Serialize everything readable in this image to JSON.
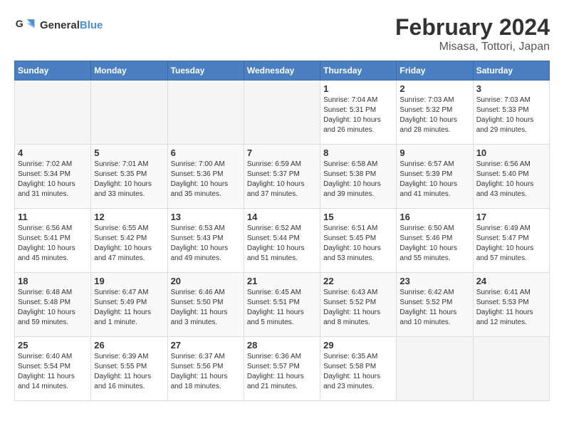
{
  "header": {
    "logo_line1": "General",
    "logo_line2": "Blue",
    "title": "February 2024",
    "subtitle": "Misasa, Tottori, Japan"
  },
  "weekdays": [
    "Sunday",
    "Monday",
    "Tuesday",
    "Wednesday",
    "Thursday",
    "Friday",
    "Saturday"
  ],
  "weeks": [
    [
      {
        "day": "",
        "info": ""
      },
      {
        "day": "",
        "info": ""
      },
      {
        "day": "",
        "info": ""
      },
      {
        "day": "",
        "info": ""
      },
      {
        "day": "1",
        "info": "Sunrise: 7:04 AM\nSunset: 5:31 PM\nDaylight: 10 hours\nand 26 minutes."
      },
      {
        "day": "2",
        "info": "Sunrise: 7:03 AM\nSunset: 5:32 PM\nDaylight: 10 hours\nand 28 minutes."
      },
      {
        "day": "3",
        "info": "Sunrise: 7:03 AM\nSunset: 5:33 PM\nDaylight: 10 hours\nand 29 minutes."
      }
    ],
    [
      {
        "day": "4",
        "info": "Sunrise: 7:02 AM\nSunset: 5:34 PM\nDaylight: 10 hours\nand 31 minutes."
      },
      {
        "day": "5",
        "info": "Sunrise: 7:01 AM\nSunset: 5:35 PM\nDaylight: 10 hours\nand 33 minutes."
      },
      {
        "day": "6",
        "info": "Sunrise: 7:00 AM\nSunset: 5:36 PM\nDaylight: 10 hours\nand 35 minutes."
      },
      {
        "day": "7",
        "info": "Sunrise: 6:59 AM\nSunset: 5:37 PM\nDaylight: 10 hours\nand 37 minutes."
      },
      {
        "day": "8",
        "info": "Sunrise: 6:58 AM\nSunset: 5:38 PM\nDaylight: 10 hours\nand 39 minutes."
      },
      {
        "day": "9",
        "info": "Sunrise: 6:57 AM\nSunset: 5:39 PM\nDaylight: 10 hours\nand 41 minutes."
      },
      {
        "day": "10",
        "info": "Sunrise: 6:56 AM\nSunset: 5:40 PM\nDaylight: 10 hours\nand 43 minutes."
      }
    ],
    [
      {
        "day": "11",
        "info": "Sunrise: 6:56 AM\nSunset: 5:41 PM\nDaylight: 10 hours\nand 45 minutes."
      },
      {
        "day": "12",
        "info": "Sunrise: 6:55 AM\nSunset: 5:42 PM\nDaylight: 10 hours\nand 47 minutes."
      },
      {
        "day": "13",
        "info": "Sunrise: 6:53 AM\nSunset: 5:43 PM\nDaylight: 10 hours\nand 49 minutes."
      },
      {
        "day": "14",
        "info": "Sunrise: 6:52 AM\nSunset: 5:44 PM\nDaylight: 10 hours\nand 51 minutes."
      },
      {
        "day": "15",
        "info": "Sunrise: 6:51 AM\nSunset: 5:45 PM\nDaylight: 10 hours\nand 53 minutes."
      },
      {
        "day": "16",
        "info": "Sunrise: 6:50 AM\nSunset: 5:46 PM\nDaylight: 10 hours\nand 55 minutes."
      },
      {
        "day": "17",
        "info": "Sunrise: 6:49 AM\nSunset: 5:47 PM\nDaylight: 10 hours\nand 57 minutes."
      }
    ],
    [
      {
        "day": "18",
        "info": "Sunrise: 6:48 AM\nSunset: 5:48 PM\nDaylight: 10 hours\nand 59 minutes."
      },
      {
        "day": "19",
        "info": "Sunrise: 6:47 AM\nSunset: 5:49 PM\nDaylight: 11 hours\nand 1 minute."
      },
      {
        "day": "20",
        "info": "Sunrise: 6:46 AM\nSunset: 5:50 PM\nDaylight: 11 hours\nand 3 minutes."
      },
      {
        "day": "21",
        "info": "Sunrise: 6:45 AM\nSunset: 5:51 PM\nDaylight: 11 hours\nand 5 minutes."
      },
      {
        "day": "22",
        "info": "Sunrise: 6:43 AM\nSunset: 5:52 PM\nDaylight: 11 hours\nand 8 minutes."
      },
      {
        "day": "23",
        "info": "Sunrise: 6:42 AM\nSunset: 5:52 PM\nDaylight: 11 hours\nand 10 minutes."
      },
      {
        "day": "24",
        "info": "Sunrise: 6:41 AM\nSunset: 5:53 PM\nDaylight: 11 hours\nand 12 minutes."
      }
    ],
    [
      {
        "day": "25",
        "info": "Sunrise: 6:40 AM\nSunset: 5:54 PM\nDaylight: 11 hours\nand 14 minutes."
      },
      {
        "day": "26",
        "info": "Sunrise: 6:39 AM\nSunset: 5:55 PM\nDaylight: 11 hours\nand 16 minutes."
      },
      {
        "day": "27",
        "info": "Sunrise: 6:37 AM\nSunset: 5:56 PM\nDaylight: 11 hours\nand 18 minutes."
      },
      {
        "day": "28",
        "info": "Sunrise: 6:36 AM\nSunset: 5:57 PM\nDaylight: 11 hours\nand 21 minutes."
      },
      {
        "day": "29",
        "info": "Sunrise: 6:35 AM\nSunset: 5:58 PM\nDaylight: 11 hours\nand 23 minutes."
      },
      {
        "day": "",
        "info": ""
      },
      {
        "day": "",
        "info": ""
      }
    ]
  ]
}
